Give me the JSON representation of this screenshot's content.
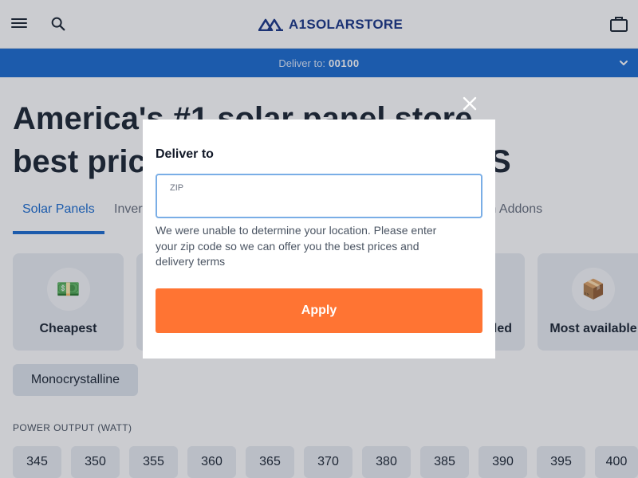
{
  "header": {
    "logo_text": "A1SOLARSTORE",
    "brand_color": "#1e3a8a"
  },
  "deliver_bar": {
    "label": "Deliver to:",
    "zip": "00100",
    "background": "#1f6fd1"
  },
  "hero": {
    "line1": "America's #1 solar panel store",
    "line2": "best prices",
    "line2_end": "S"
  },
  "tabs": [
    {
      "label": "Solar Panels",
      "active": true
    },
    {
      "label": "Inverters",
      "active": false
    },
    {
      "label": "m Addons",
      "active": false
    }
  ],
  "filter_cards": [
    {
      "label": "Cheapest",
      "icon": "money-icon"
    },
    {
      "label": "lled",
      "icon": ""
    },
    {
      "label": "Most available",
      "icon": "box-icon"
    }
  ],
  "chip": {
    "label": "Monocrystalline"
  },
  "power_output": {
    "label": "POWER OUTPUT (WATT)",
    "options": [
      "345",
      "350",
      "355",
      "360",
      "365",
      "370",
      "380",
      "385",
      "390",
      "395",
      "400"
    ]
  },
  "modal": {
    "title": "Deliver to",
    "zip_label": "ZIP",
    "zip_value": "",
    "message": "We were unable to determine your location. Please enter your zip code so we can offer you the best prices and delivery terms",
    "apply_label": "Apply",
    "apply_color": "#ff7433"
  }
}
